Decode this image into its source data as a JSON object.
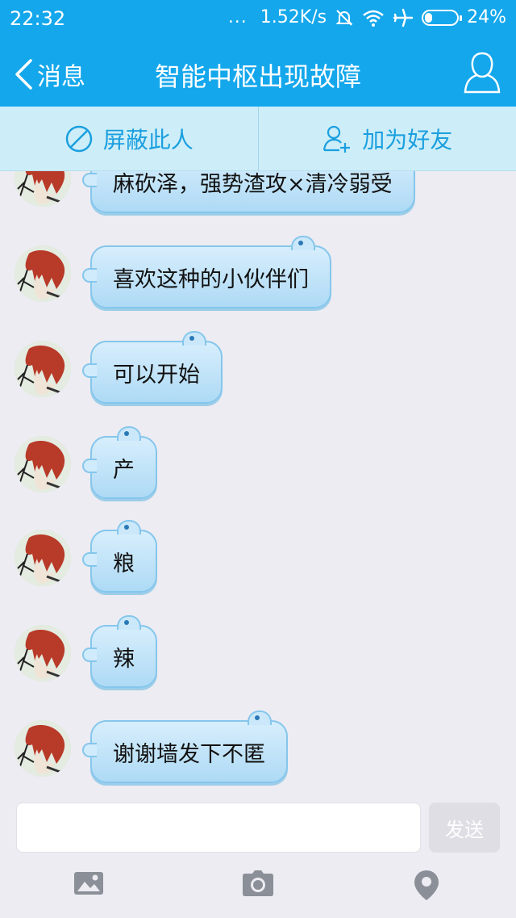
{
  "status_bar": {
    "time": "22:32",
    "dots": "...",
    "speed": "1.52K/s",
    "battery": "24%",
    "battery_level": 0.24
  },
  "nav": {
    "back_label": "消息",
    "title": "智能中枢出现故障"
  },
  "actions": {
    "block_label": "屏蔽此人",
    "add_friend_label": "加为好友"
  },
  "messages": [
    {
      "text": "麻砍泽，强势渣攻×清冷弱受"
    },
    {
      "text": "喜欢这种的小伙伴们"
    },
    {
      "text": "可以开始"
    },
    {
      "text": "产"
    },
    {
      "text": "粮"
    },
    {
      "text": "辣"
    },
    {
      "text": "谢谢墙发下不匿"
    }
  ],
  "input": {
    "placeholder": "",
    "send_label": "发送"
  },
  "toolbar": {
    "icons": [
      "image-icon",
      "camera-icon",
      "location-icon"
    ]
  },
  "colors": {
    "header": "#14a7ec",
    "action_bar": "#cdeef9",
    "accent": "#1a9fdf",
    "bubble": "#aedaf5",
    "background": "#ececf2"
  }
}
